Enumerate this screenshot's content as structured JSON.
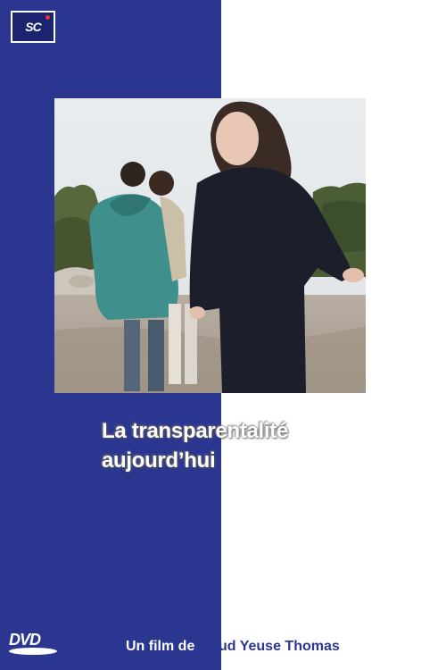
{
  "cover": {
    "title_line1": "La transparentalité",
    "title_line2": "aujourd’hui",
    "credit_prefix": "Un film de ",
    "credit_director": "Maud Yeuse Thomas",
    "publisher_logo_text": "SC",
    "dvd_logo_text": "DVD",
    "colors": {
      "panel_blue": "#2b3691",
      "background_white": "#ffffff",
      "logo_accent": "#e23b2e"
    },
    "photo_icon": "photo-of-people-on-beach"
  }
}
